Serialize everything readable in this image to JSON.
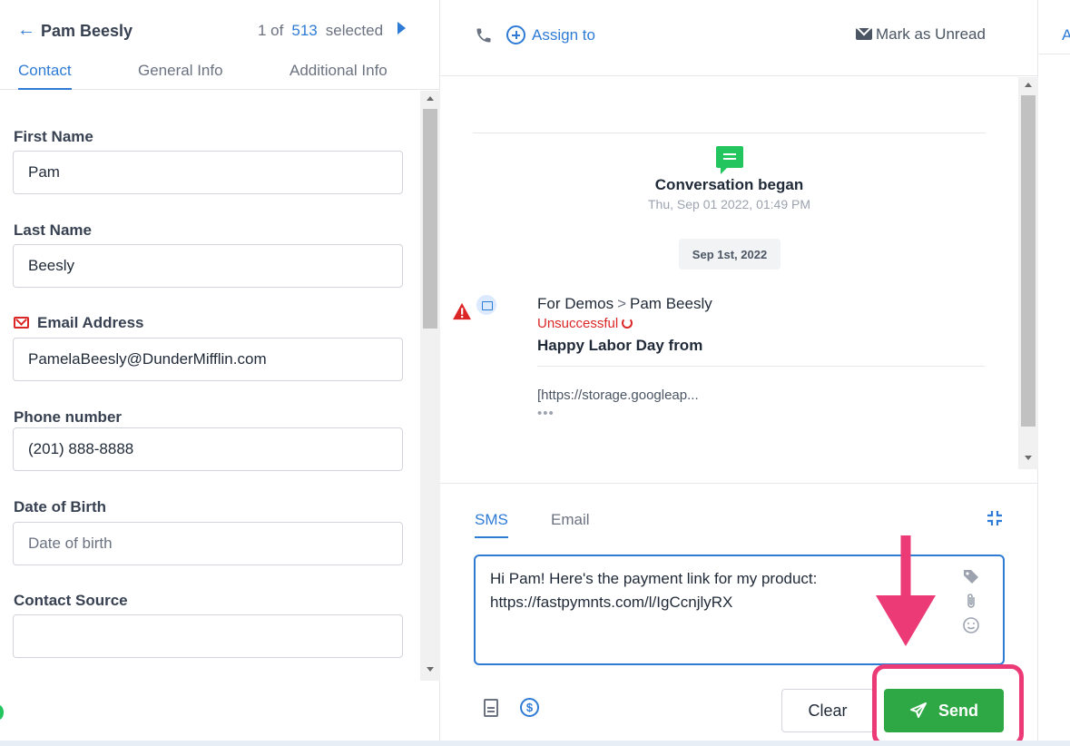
{
  "contact": {
    "name": "Pam Beesly",
    "pager": {
      "prefix": "1 of",
      "count": "513",
      "suffix": "selected"
    },
    "tabs": [
      "Contact",
      "General Info",
      "Additional Info"
    ]
  },
  "form": {
    "first_name": {
      "label": "First Name",
      "value": "Pam"
    },
    "last_name": {
      "label": "Last Name",
      "value": "Beesly"
    },
    "email": {
      "label": "Email Address",
      "value": "PamelaBeesly@DunderMifflin.com"
    },
    "phone": {
      "label": "Phone number",
      "value": "(201) 888-8888"
    },
    "dob": {
      "label": "Date of Birth",
      "placeholder": "Date of birth"
    },
    "source": {
      "label": "Contact Source",
      "value": ""
    }
  },
  "header": {
    "assign_label": "Assign to",
    "unread_label": "Mark as Unread",
    "right_tab_partial": "A"
  },
  "conversation": {
    "began_title": "Conversation began",
    "began_time": "Thu, Sep 01 2022, 01:49 PM",
    "date_pill": "Sep 1st, 2022",
    "message": {
      "from": "For Demos",
      "separator": ">",
      "to": "Pam Beesly",
      "status": "Unsuccessful",
      "subject": "Happy Labor Day from",
      "body_preview": "[https://storage.googleap...",
      "more": "•••"
    }
  },
  "composer": {
    "tabs": [
      "SMS",
      "Email"
    ],
    "message_text": "Hi Pam! Here's the payment link for my product:\nhttps://fastpymnts.com/l/IgCcnjlyRX",
    "clear_label": "Clear",
    "send_label": "Send"
  },
  "colors": {
    "accent": "#2e7bd6",
    "send_green": "#2da844",
    "error_red": "#dc2626",
    "annotation_pink": "#ec3a77",
    "chat_green": "#22c55e"
  }
}
